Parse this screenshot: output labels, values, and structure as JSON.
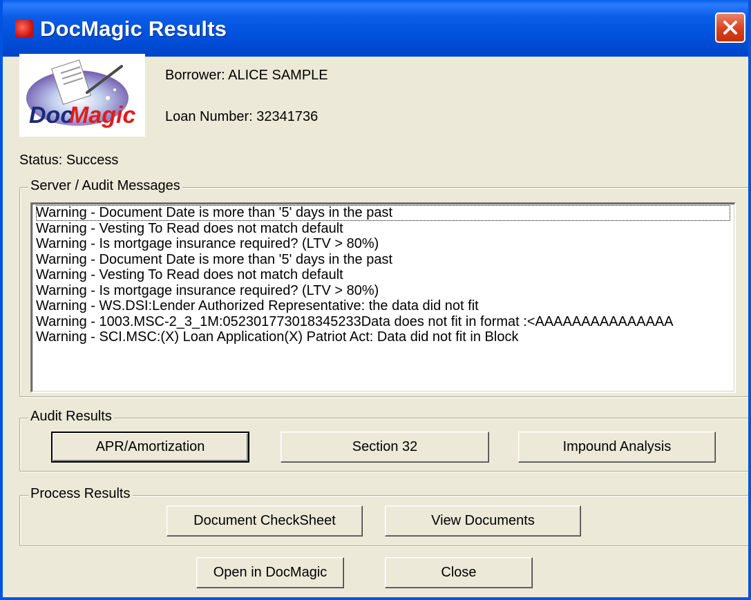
{
  "window": {
    "title": "DocMagic Results",
    "title_icon": "docmagic-app-icon",
    "close_icon": "close-x-icon",
    "accent_color": "#0054e3",
    "close_color": "#d8401e"
  },
  "logo": {
    "text_doc": "Doc",
    "text_magic": "Magic"
  },
  "info": {
    "borrower": "Borrower: ALICE SAMPLE",
    "loan_number": "Loan Number: 32341736",
    "status": "Status: Success"
  },
  "messages": {
    "legend": "Server / Audit Messages",
    "items": [
      "Warning - Document Date is more than '5' days in the past",
      "Warning - Vesting To Read does not match default",
      "Warning - Is mortgage insurance required? (LTV > 80%)",
      "Warning - Document Date is more than '5' days in the past",
      "Warning - Vesting To Read does not match default",
      "Warning - Is mortgage insurance required? (LTV > 80%)",
      "Warning - WS.DSI:Lender Authorized Representative: the data did not fit",
      "Warning - 1003.MSC-2_3_1M:052301773018345233Data does not fit in format :<AAAAAAAAAAAAAAA",
      "Warning - SCI.MSC:(X) Loan Application(X) Patriot Act: Data did not fit in Block"
    ]
  },
  "audit": {
    "legend": "Audit Results",
    "apr_label": "APR/Amortization",
    "section32_label": "Section 32",
    "impound_label": "Impound Analysis"
  },
  "process": {
    "legend": "Process Results",
    "checksheet_label": "Document CheckSheet",
    "view_label": "View Documents"
  },
  "footer": {
    "open_label": "Open in DocMagic",
    "close_label": "Close"
  }
}
